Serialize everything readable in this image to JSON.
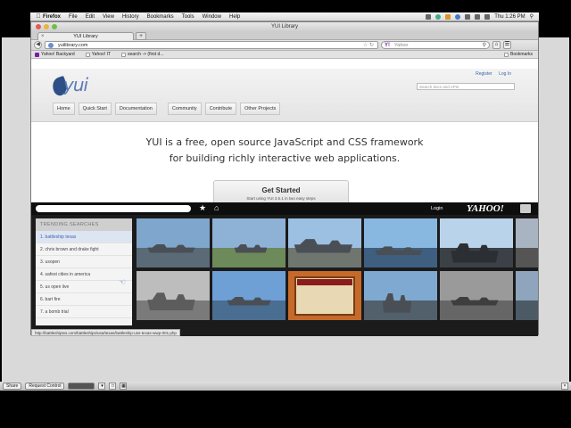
{
  "menubar": {
    "app": "Firefox",
    "items": [
      "File",
      "Edit",
      "View",
      "History",
      "Bookmarks",
      "Tools",
      "Window",
      "Help"
    ],
    "clock": "Thu 1:26 PM"
  },
  "window": {
    "title": "YUI Library",
    "tab_label": "YUI Library",
    "url": "yuilibrary.com",
    "search_placeholder": "Yahoo",
    "bookmarks": [
      "Yahoo! Backyard",
      "Yahoo! IT",
      "search -> (first d..."
    ],
    "bookmarks_menu": "Bookmarks"
  },
  "page": {
    "logo": "yui",
    "top_links": [
      "Register",
      "Log In"
    ],
    "site_search_placeholder": "Search docs and APIs",
    "nav": [
      "Home",
      "Quick Start",
      "Documentation",
      "Community",
      "Contribute",
      "Other Projects"
    ],
    "tagline_line1": "YUI is a free, open source JavaScript and CSS framework",
    "tagline_line2": "for building richly interactive web applications.",
    "cta_label": "Get Started",
    "cta_sub": "Start using YUI 3.5.1 in two easy steps"
  },
  "overlay": {
    "login": "Login",
    "brand": "YAHOO!",
    "trending_header": "TRENDING SEARCHES",
    "trending": [
      "1. battleship texas",
      "2. chris brown and drake fight",
      "3. usopen",
      "4. safest cities in america",
      "5. us open live",
      "6. bart fire",
      "7. a bomb trial"
    ],
    "status_url": "http://battleshiptxs.com/battleships/usa/texas/battleship-uss-texas-wwp-001.php"
  },
  "viewer": {
    "share": "Share",
    "request_control": "Request Control"
  },
  "colors": {
    "accent": "#3b66b0",
    "overlay_bg": "#1b1b1b",
    "selected_row": "#dde5f2"
  }
}
